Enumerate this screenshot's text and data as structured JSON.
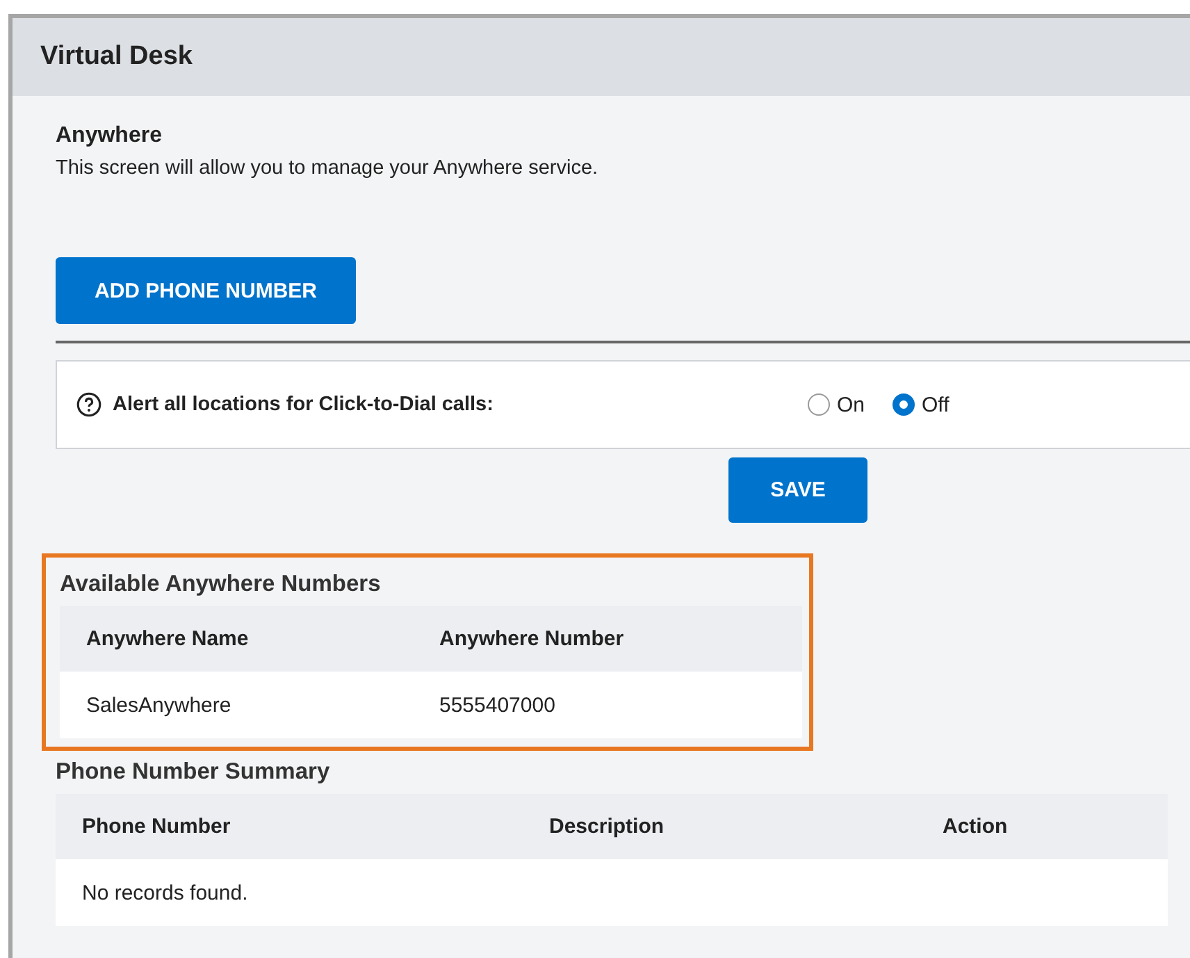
{
  "window": {
    "title": "Virtual Desk"
  },
  "section": {
    "title": "Anywhere",
    "description": "This screen will allow you to manage your Anywhere service."
  },
  "add_button": "ADD PHONE NUMBER",
  "alert_setting": {
    "label": "Alert all locations for Click-to-Dial calls:",
    "options": [
      {
        "label": "On",
        "selected": false
      },
      {
        "label": "Off",
        "selected": true
      }
    ]
  },
  "save_button": "SAVE",
  "available_numbers": {
    "title": "Available Anywhere Numbers",
    "highlighted": true,
    "columns": [
      "Anywhere Name",
      "Anywhere Number"
    ],
    "rows": [
      [
        "SalesAnywhere",
        "5555407000"
      ]
    ]
  },
  "phone_summary": {
    "title": "Phone Number Summary",
    "columns": [
      "Phone Number",
      "Description",
      "Action"
    ],
    "empty_text": "No records found."
  }
}
